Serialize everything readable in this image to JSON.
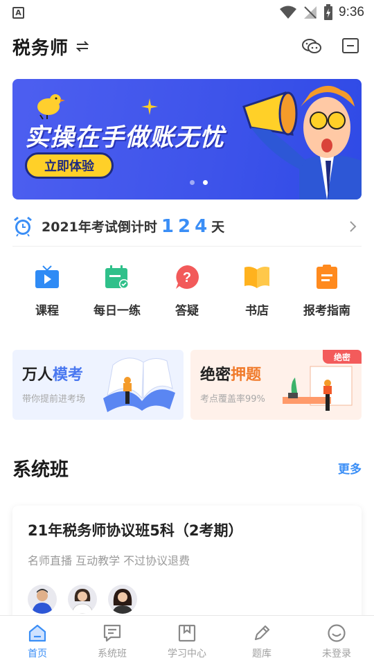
{
  "status_bar": {
    "time": "9:36",
    "indicator": "A"
  },
  "header": {
    "title": "税务师",
    "icons": [
      "switch-icon",
      "wechat-icon",
      "message-icon"
    ]
  },
  "banner": {
    "title": "实操在手做账无忧",
    "button": "立即体验",
    "active_dot": 2,
    "dot_count": 2
  },
  "countdown": {
    "prefix": "2021年考试倒计时",
    "days": "124",
    "unit": "天"
  },
  "quick_nav": [
    {
      "label": "课程",
      "icon": "tv-play-icon",
      "color": "#2f8bf5"
    },
    {
      "label": "每日一练",
      "icon": "calendar-check-icon",
      "color": "#2fc08a"
    },
    {
      "label": "答疑",
      "icon": "question-icon",
      "color": "#f25a5a"
    },
    {
      "label": "书店",
      "icon": "book-icon",
      "color": "#ffb21e"
    },
    {
      "label": "报考指南",
      "icon": "clipboard-icon",
      "color": "#ff8a1e"
    }
  ],
  "promo_cards": [
    {
      "title_a": "万人",
      "title_b": "模考",
      "subtitle": "带你提前进考场"
    },
    {
      "title_a": "绝密",
      "title_b": "押题",
      "subtitle": "考点覆盖率99%",
      "badge": "绝密"
    }
  ],
  "section": {
    "title": "系统班",
    "more": "更多"
  },
  "course": {
    "title": "21年税务师协议班5科（2考期）",
    "subtitle": "名师直播 互动教学 不过协议退费"
  },
  "bottom_nav": [
    {
      "label": "首页",
      "icon": "home-icon",
      "active": true
    },
    {
      "label": "系统班",
      "icon": "chat-list-icon",
      "active": false
    },
    {
      "label": "学习中心",
      "icon": "bookmark-book-icon",
      "active": false
    },
    {
      "label": "题库",
      "icon": "pencil-icon",
      "active": false
    },
    {
      "label": "未登录",
      "icon": "smile-icon",
      "active": false
    }
  ],
  "colors": {
    "accent": "#3a8ef6",
    "banner": "#3d53ea",
    "button_yellow": "#ffd028"
  }
}
